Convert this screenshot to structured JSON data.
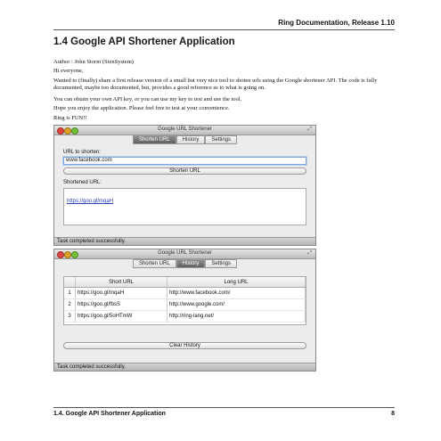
{
  "header": {
    "right_title": "Ring Documentation, Release 1.10"
  },
  "section": {
    "title": "1.4  Google API Shortener Application"
  },
  "paragraphs": [
    "Author : John Storm (SienSystem)",
    "Hi everyone,",
    "Wanted to (finally) share a first release version of a small but very nice tool to shoten urls using the Google shortener API. The code is fully documented, maybe too documented, but, provides a good reference as to what is going on.",
    "You can obtain your own API key, or you can use my key to test and use the tool.",
    "Hope you enjoy the application. Please feel free to test at your convenience.",
    "Ring is FUN!!"
  ],
  "window1": {
    "title": "Google URL Shortener",
    "tabs": [
      "Shorten URL",
      "History",
      "Settings"
    ],
    "active_tab": 0,
    "url_label": "URL to shorten:",
    "url_value": "www.facebook.com",
    "shorten_button": "Shorten URL",
    "shortened_label": "Shortened URL:",
    "shortened_value": "https://goo.gl/mqaH",
    "status": "Task completed successfully."
  },
  "window2": {
    "title": "Google URL Shortener",
    "tabs": [
      "Shorten URL",
      "History",
      "Settings"
    ],
    "active_tab": 1,
    "columns": [
      "Short URL",
      "Long URL"
    ],
    "rows": [
      {
        "n": "1",
        "short": "https://goo.gl/mqaH",
        "long": "http://www.facebook.com/"
      },
      {
        "n": "2",
        "short": "https://goo.gl/fbsS",
        "long": "http://www.google.com/"
      },
      {
        "n": "3",
        "short": "https://goo.gl/5oHTmW",
        "long": "http://ring-lang.net/"
      }
    ],
    "clear_button": "Clear History",
    "status": "Task completed successfully."
  },
  "footer": {
    "left": "1.4.  Google API Shortener Application",
    "page": "8"
  },
  "icons": {
    "resize": "resize-icon",
    "close": "close-dot",
    "minimize": "minimize-dot",
    "zoom": "zoom-dot"
  },
  "colors": {
    "close": "#e0443e",
    "minimize": "#dea123",
    "zoom": "#74c036",
    "link": "#2a43b8"
  }
}
